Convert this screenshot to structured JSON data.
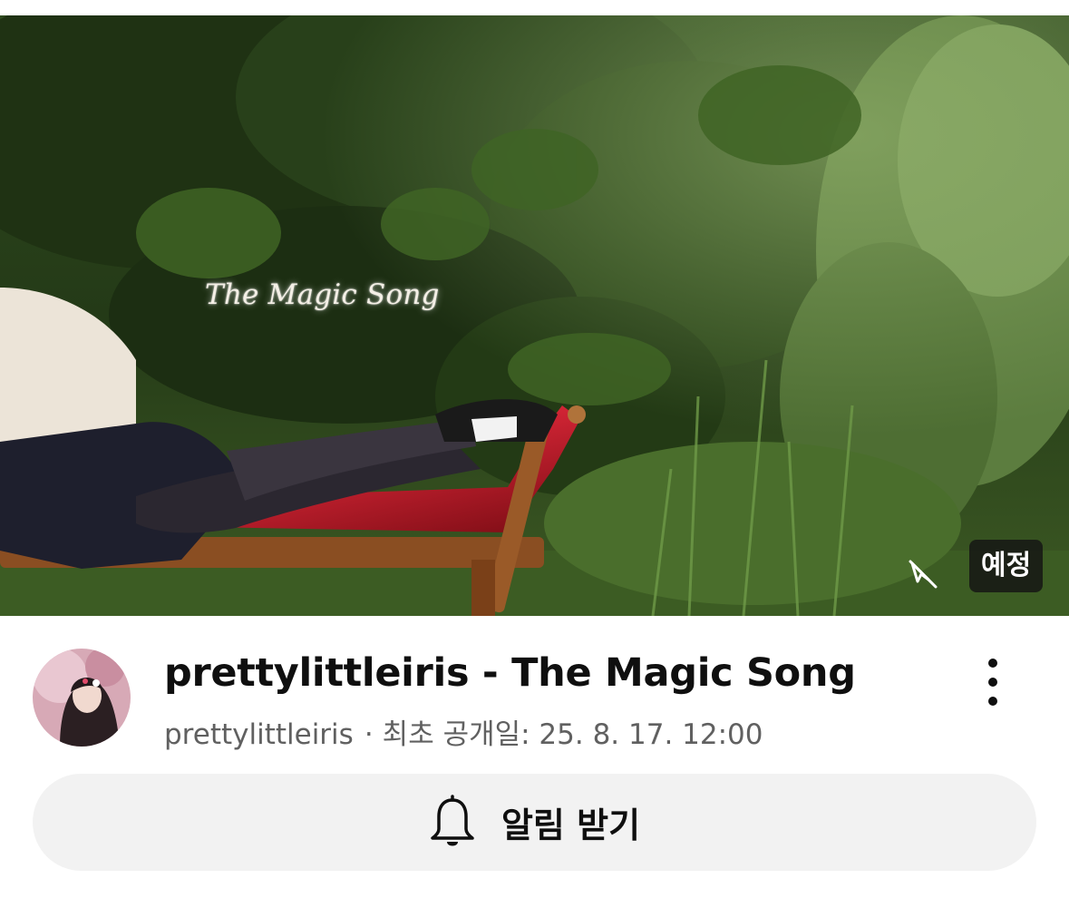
{
  "thumbnail": {
    "overlay_title": "The Magic Song",
    "badge_label": "예정",
    "status_icon": "link-off-icon"
  },
  "video": {
    "title": "prettylittleiris - The Magic Song",
    "channel": "prettylittleiris",
    "separator": "·",
    "premiere_text": "최초 공개일: 25. 8. 17. 12:00"
  },
  "actions": {
    "more_icon": "more-vertical-icon",
    "notify_icon": "bell-icon",
    "notify_label": "알림 받기"
  },
  "colors": {
    "title_text": "#0f0f0f",
    "secondary_text": "#606060",
    "button_bg": "#f2f2f2",
    "badge_bg": "#141414"
  }
}
